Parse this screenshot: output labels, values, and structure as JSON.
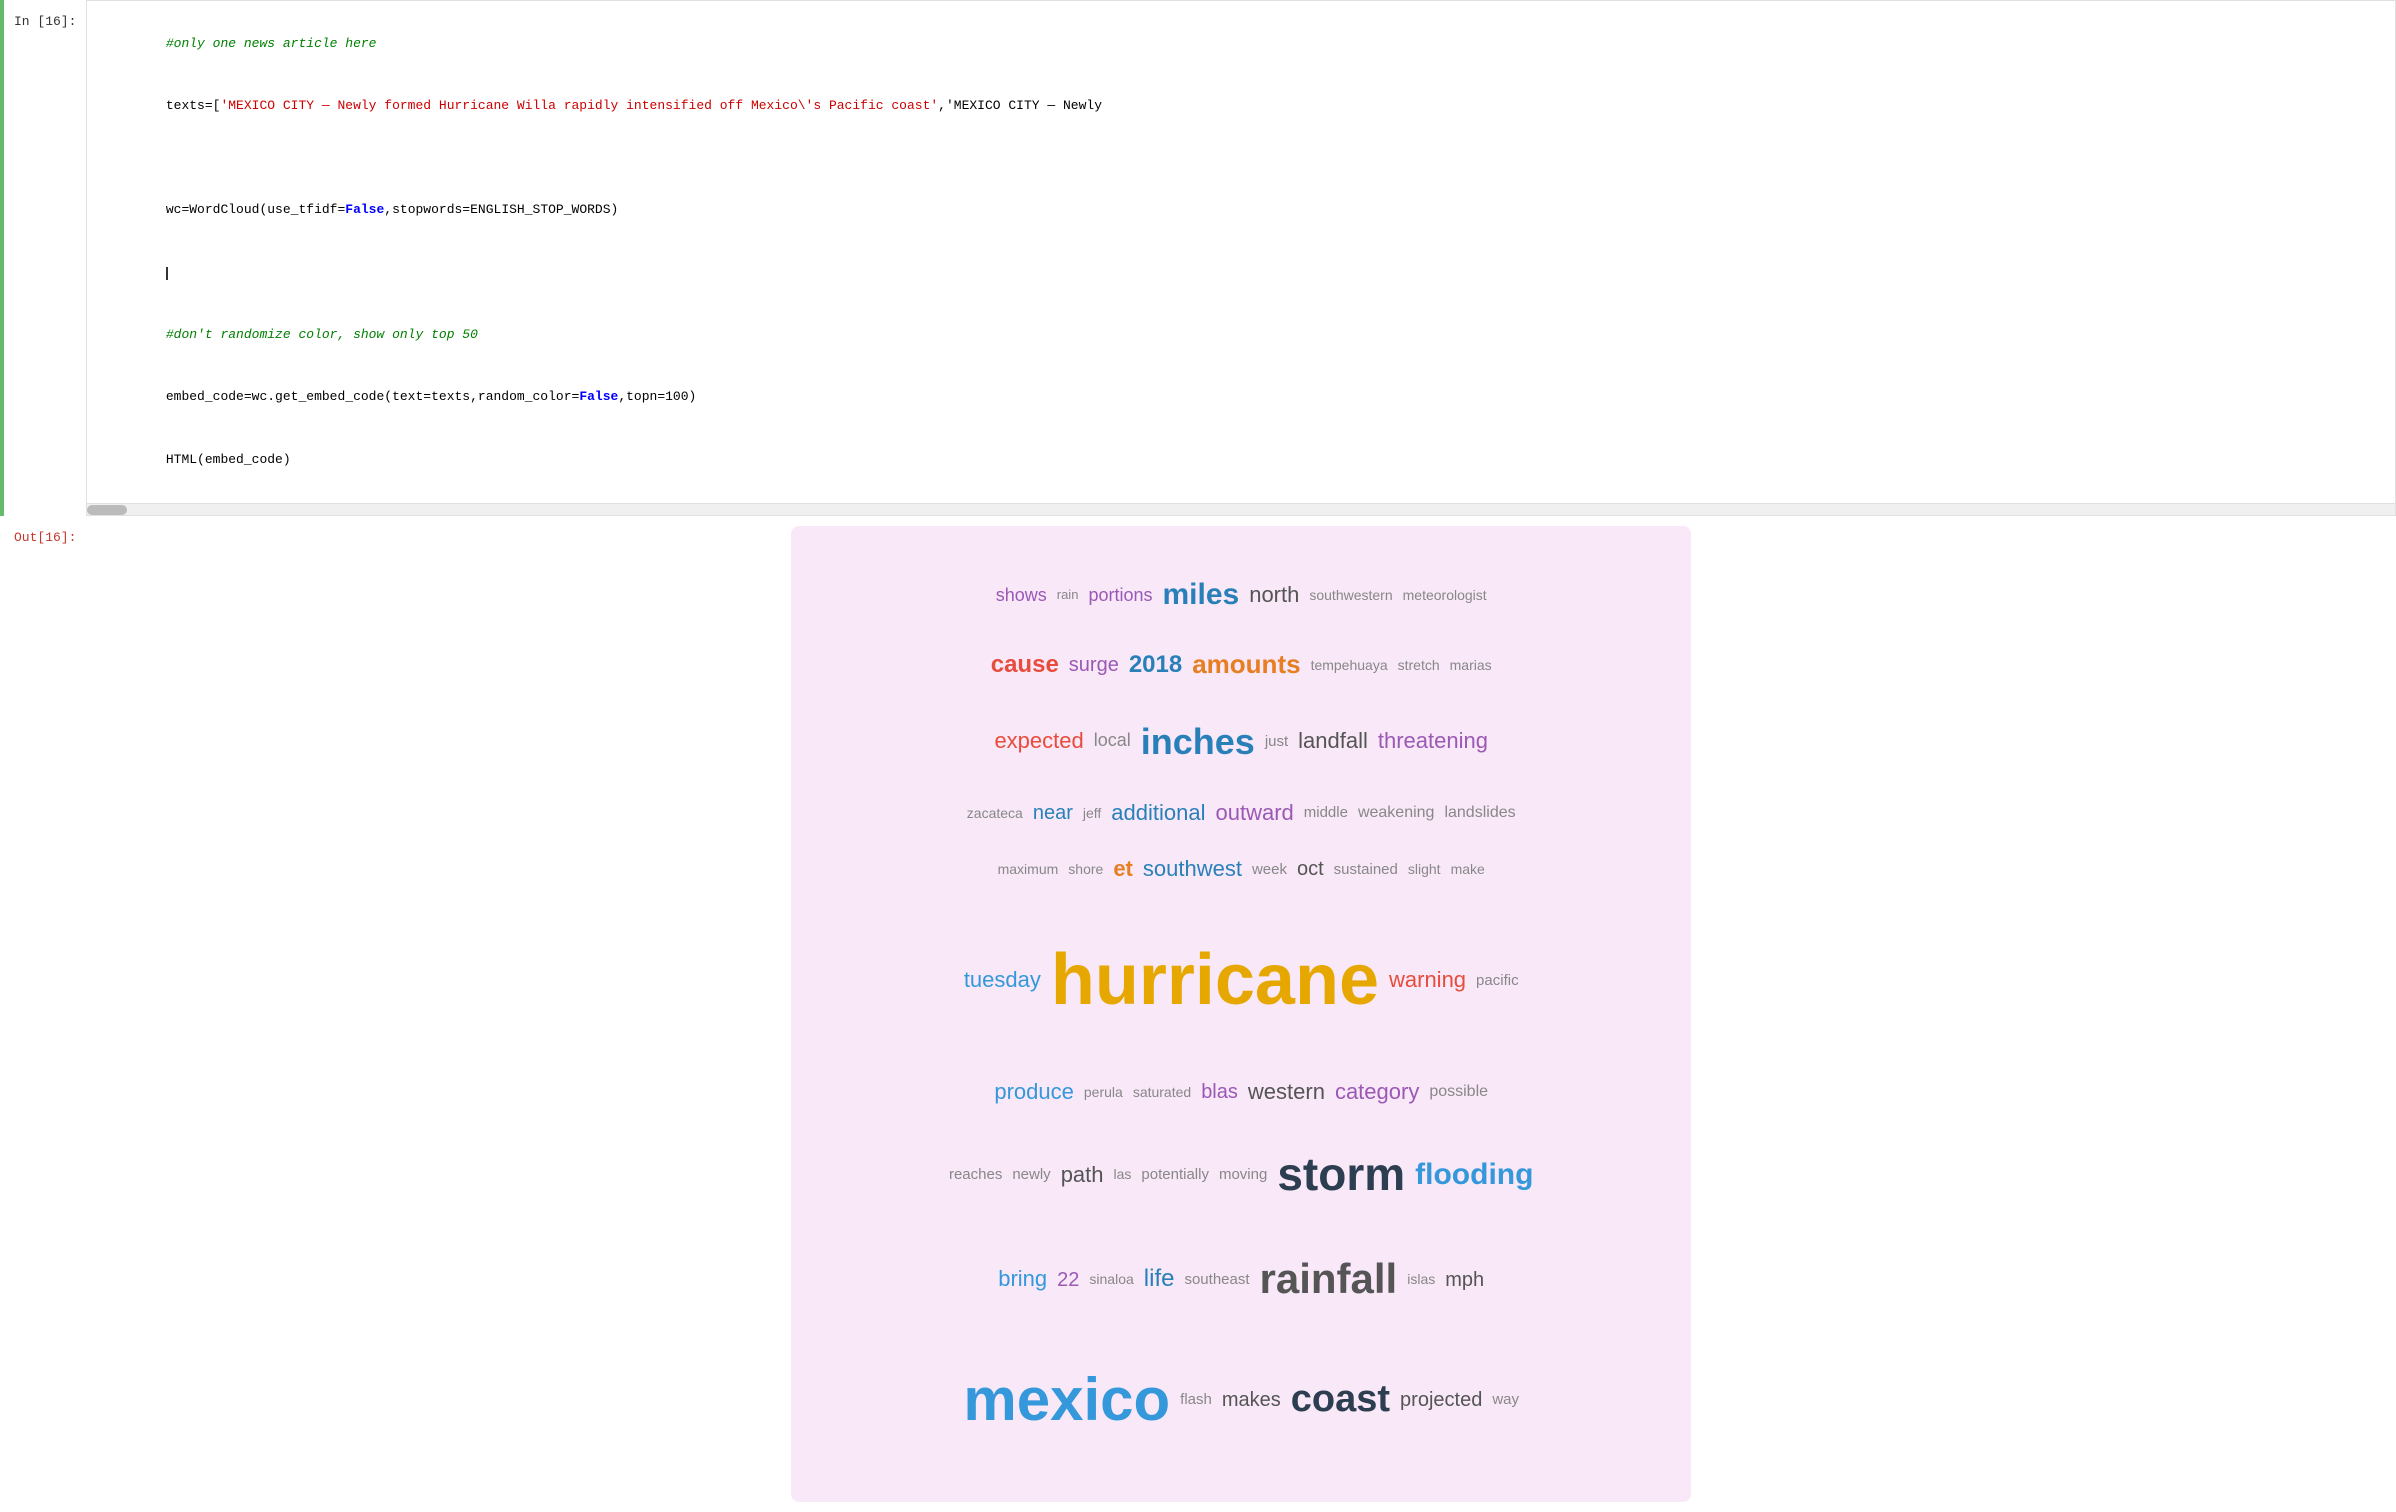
{
  "cell_input": {
    "label": "In [16]:",
    "lines": [
      {
        "type": "comment",
        "text": "#only one news article here"
      },
      {
        "type": "code",
        "parts": [
          {
            "t": "normal",
            "v": "texts=["
          },
          {
            "t": "string",
            "v": "'MEXICO CITY — Newly formed Hurricane Willa rapidly intensified off Mexico\\'s Pacific coast'"
          },
          {
            "t": "normal",
            "v": ",'MEXICO CITY — Newly"
          }
        ]
      },
      {
        "type": "empty"
      },
      {
        "type": "code",
        "parts": [
          {
            "t": "normal",
            "v": "wc=WordCloud(use_tfidf="
          },
          {
            "t": "false",
            "v": "False"
          },
          {
            "t": "normal",
            "v": ",stopwords=ENGLISH_STOP_WORDS)"
          }
        ]
      },
      {
        "type": "cursor"
      },
      {
        "type": "comment",
        "text": "#don't randomize color, show only top 50"
      },
      {
        "type": "code",
        "parts": [
          {
            "t": "normal",
            "v": "embed_code=wc.get_embed_code(text=texts,random_color="
          },
          {
            "t": "false",
            "v": "False"
          },
          {
            "t": "normal",
            "v": ",topn=100)"
          }
        ]
      },
      {
        "type": "code",
        "parts": [
          {
            "t": "normal",
            "v": "HTML(embed_code)"
          }
        ]
      }
    ]
  },
  "cell_output": {
    "label": "Out[16]:",
    "wordcloud": {
      "words": [
        {
          "text": "shows",
          "size": 18,
          "color": "#9b59b6",
          "bold": false
        },
        {
          "text": "rain",
          "size": 13,
          "color": "#888",
          "bold": false
        },
        {
          "text": "portions",
          "size": 18,
          "color": "#9b59b6",
          "bold": false
        },
        {
          "text": "miles",
          "size": 30,
          "color": "#2980b9",
          "bold": true
        },
        {
          "text": "north",
          "size": 22,
          "color": "#555",
          "bold": false
        },
        {
          "text": "southwestern",
          "size": 14,
          "color": "#888",
          "bold": false
        },
        {
          "text": "meteorologist",
          "size": 14,
          "color": "#888",
          "bold": false
        },
        {
          "text": "cause",
          "size": 24,
          "color": "#e74c3c",
          "bold": true
        },
        {
          "text": "surge",
          "size": 20,
          "color": "#9b59b6",
          "bold": false
        },
        {
          "text": "2018",
          "size": 24,
          "color": "#2980b9",
          "bold": true
        },
        {
          "text": "amounts",
          "size": 26,
          "color": "#e67e22",
          "bold": true
        },
        {
          "text": "tempehuaya",
          "size": 14,
          "color": "#888",
          "bold": false
        },
        {
          "text": "stretch",
          "size": 14,
          "color": "#888",
          "bold": false
        },
        {
          "text": "marias",
          "size": 14,
          "color": "#888",
          "bold": false
        },
        {
          "text": "expected",
          "size": 22,
          "color": "#e74c3c",
          "bold": false
        },
        {
          "text": "local",
          "size": 18,
          "color": "#888",
          "bold": false
        },
        {
          "text": "inches",
          "size": 36,
          "color": "#2980b9",
          "bold": true
        },
        {
          "text": "just",
          "size": 15,
          "color": "#888",
          "bold": false
        },
        {
          "text": "landfall",
          "size": 22,
          "color": "#555",
          "bold": false
        },
        {
          "text": "threatening",
          "size": 22,
          "color": "#9b59b6",
          "bold": false
        },
        {
          "text": "zacateca",
          "size": 14,
          "color": "#888",
          "bold": false
        },
        {
          "text": "near",
          "size": 20,
          "color": "#2980b9",
          "bold": false
        },
        {
          "text": "jeff",
          "size": 14,
          "color": "#888",
          "bold": false
        },
        {
          "text": "additional",
          "size": 22,
          "color": "#2980b9",
          "bold": false
        },
        {
          "text": "outward",
          "size": 22,
          "color": "#9b59b6",
          "bold": false
        },
        {
          "text": "middle",
          "size": 15,
          "color": "#888",
          "bold": false
        },
        {
          "text": "weakening",
          "size": 16,
          "color": "#888",
          "bold": false
        },
        {
          "text": "landslides",
          "size": 16,
          "color": "#888",
          "bold": false
        },
        {
          "text": "maximum",
          "size": 14,
          "color": "#888",
          "bold": false
        },
        {
          "text": "shore",
          "size": 14,
          "color": "#888",
          "bold": false
        },
        {
          "text": "et",
          "size": 22,
          "color": "#e67e22",
          "bold": true
        },
        {
          "text": "southwest",
          "size": 22,
          "color": "#2980b9",
          "bold": false
        },
        {
          "text": "week",
          "size": 15,
          "color": "#888",
          "bold": false
        },
        {
          "text": "oct",
          "size": 20,
          "color": "#555",
          "bold": false
        },
        {
          "text": "sustained",
          "size": 15,
          "color": "#888",
          "bold": false
        },
        {
          "text": "slight",
          "size": 14,
          "color": "#888",
          "bold": false
        },
        {
          "text": "make",
          "size": 14,
          "color": "#888",
          "bold": false
        },
        {
          "text": "tuesday",
          "size": 22,
          "color": "#3498db",
          "bold": false
        },
        {
          "text": "hurricane",
          "size": 72,
          "color": "#e6a800",
          "bold": true
        },
        {
          "text": "warning",
          "size": 22,
          "color": "#e74c3c",
          "bold": false
        },
        {
          "text": "pacific",
          "size": 15,
          "color": "#888",
          "bold": false
        },
        {
          "text": "produce",
          "size": 22,
          "color": "#3498db",
          "bold": false
        },
        {
          "text": "perula",
          "size": 14,
          "color": "#888",
          "bold": false
        },
        {
          "text": "saturated",
          "size": 14,
          "color": "#888",
          "bold": false
        },
        {
          "text": "blas",
          "size": 20,
          "color": "#9b59b6",
          "bold": false
        },
        {
          "text": "western",
          "size": 22,
          "color": "#555",
          "bold": false
        },
        {
          "text": "category",
          "size": 22,
          "color": "#9b59b6",
          "bold": false
        },
        {
          "text": "possible",
          "size": 16,
          "color": "#888",
          "bold": false
        },
        {
          "text": "reaches",
          "size": 15,
          "color": "#888",
          "bold": false
        },
        {
          "text": "newly",
          "size": 15,
          "color": "#888",
          "bold": false
        },
        {
          "text": "path",
          "size": 22,
          "color": "#555",
          "bold": false
        },
        {
          "text": "las",
          "size": 14,
          "color": "#888",
          "bold": false
        },
        {
          "text": "potentially",
          "size": 15,
          "color": "#888",
          "bold": false
        },
        {
          "text": "moving",
          "size": 15,
          "color": "#888",
          "bold": false
        },
        {
          "text": "storm",
          "size": 46,
          "color": "#2c3e50",
          "bold": true
        },
        {
          "text": "flooding",
          "size": 30,
          "color": "#3498db",
          "bold": true
        },
        {
          "text": "bring",
          "size": 22,
          "color": "#3498db",
          "bold": false
        },
        {
          "text": "22",
          "size": 20,
          "color": "#9b59b6",
          "bold": false
        },
        {
          "text": "sinaloa",
          "size": 14,
          "color": "#888",
          "bold": false
        },
        {
          "text": "life",
          "size": 24,
          "color": "#2980b9",
          "bold": false
        },
        {
          "text": "southeast",
          "size": 15,
          "color": "#888",
          "bold": false
        },
        {
          "text": "rainfall",
          "size": 42,
          "color": "#555",
          "bold": true
        },
        {
          "text": "islas",
          "size": 14,
          "color": "#888",
          "bold": false
        },
        {
          "text": "mph",
          "size": 20,
          "color": "#555",
          "bold": false
        },
        {
          "text": "mexico",
          "size": 60,
          "color": "#3498db",
          "bold": true
        },
        {
          "text": "flash",
          "size": 15,
          "color": "#888",
          "bold": false
        },
        {
          "text": "makes",
          "size": 20,
          "color": "#555",
          "bold": false
        },
        {
          "text": "coast",
          "size": 38,
          "color": "#2c3e50",
          "bold": true
        },
        {
          "text": "projected",
          "size": 20,
          "color": "#555",
          "bold": false
        },
        {
          "text": "way",
          "size": 15,
          "color": "#888",
          "bold": false
        }
      ]
    }
  }
}
